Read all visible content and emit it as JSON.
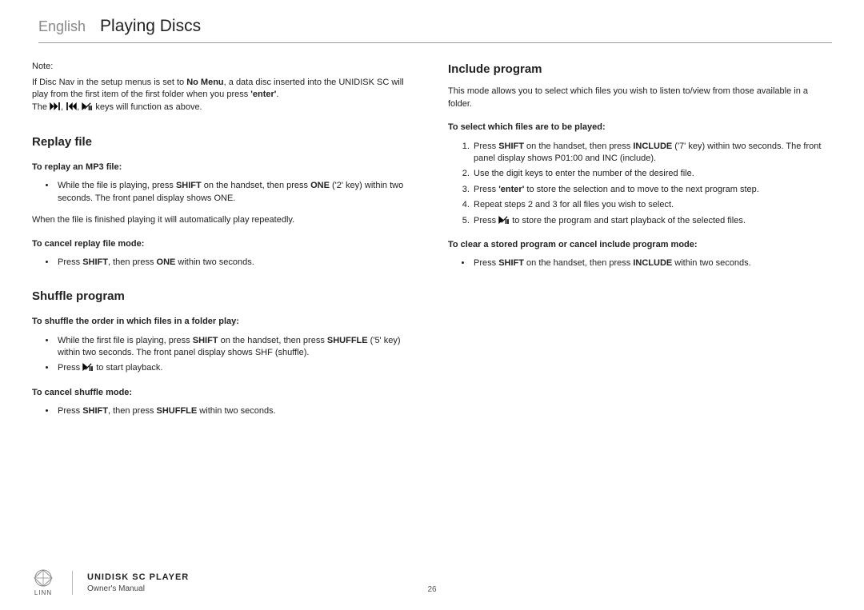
{
  "header": {
    "language": "English",
    "title": "Playing Discs"
  },
  "left": {
    "note_label": "Note:",
    "note_line1a": "If Disc Nav in the setup menus is set to ",
    "note_line1b": "No Menu",
    "note_line1c": ", a data disc inserted into the UNIDISK SC will play from the first item of the first folder when you press ",
    "note_line1d": "'enter'",
    "note_line1e": ".",
    "note_line2a": "The ",
    "note_line2b": " keys will function as above.",
    "replay": {
      "title": "Replay file",
      "sub1": "To replay an MP3 file:",
      "bullet1a": "While the file is playing, press ",
      "bullet1b": "SHIFT",
      "bullet1c": " on the handset, then press ",
      "bullet1d": "ONE",
      "bullet1e": " ('2' key) within two seconds. The front panel display shows ONE.",
      "para": "When the file is finished playing it will automatically play repeatedly.",
      "sub2": "To cancel replay file mode:",
      "bullet2a": "Press ",
      "bullet2b": "SHIFT",
      "bullet2c": ", then press ",
      "bullet2d": "ONE",
      "bullet2e": " within two seconds."
    },
    "shuffle": {
      "title": "Shuffle program",
      "sub1": "To shuffle the order in which files in a folder play:",
      "b1a": "While the first file is playing, press ",
      "b1b": "SHIFT",
      "b1c": " on the handset, then press ",
      "b1d": "SHUFFLE",
      "b1e": " ('5' key) within two seconds. The front panel display shows SHF (shuffle).",
      "b2a": "Press ",
      "b2b": " to start playback.",
      "sub2": "To cancel shuffle mode:",
      "c1a": "Press ",
      "c1b": "SHIFT",
      "c1c": ", then press ",
      "c1d": "SHUFFLE",
      "c1e": " within two seconds."
    }
  },
  "right": {
    "include": {
      "title": "Include program",
      "intro": "This mode allows you to select which files you wish to listen to/view from those available in a folder.",
      "sub1": "To select which files are to be played:",
      "n1a": "Press ",
      "n1b": "SHIFT",
      "n1c": " on the handset, then press ",
      "n1d": "INCLUDE",
      "n1e": " ('7' key) within two seconds. The front panel display shows P01:00 and INC (include).",
      "n2": "Use the digit keys to enter the number of the desired file.",
      "n3a": "Press ",
      "n3b": "'enter'",
      "n3c": " to store the selection and to move to the next program step.",
      "n4": "Repeat steps 2 and 3 for all files you wish to select.",
      "n5a": "Press ",
      "n5b": " to store the program and start playback of the selected files.",
      "sub2": "To clear a stored program or cancel include program mode:",
      "c1a": "Press ",
      "c1b": "SHIFT",
      "c1c": " on the handset, then press ",
      "c1d": "INCLUDE",
      "c1e": " within two seconds."
    }
  },
  "footer": {
    "brand": "LINN",
    "product": "UNIDISK SC PLAYER",
    "manual": "Owner's Manual",
    "page": "26"
  },
  "icons": {
    "nextTrack": "next-track-icon",
    "prevTrack": "prev-track-icon",
    "playPause": "play-pause-icon"
  }
}
